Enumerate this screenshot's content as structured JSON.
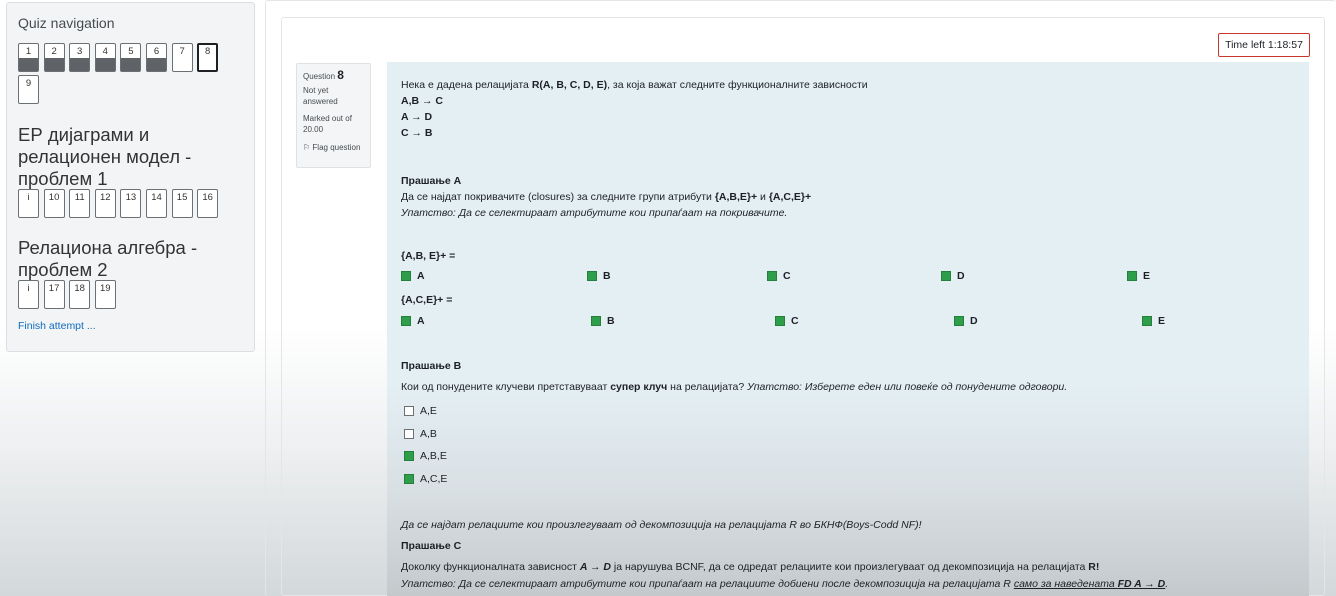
{
  "nav": {
    "title": "Quiz navigation",
    "row1": [
      "1",
      "2",
      "3",
      "4",
      "5",
      "6",
      "7",
      "8"
    ],
    "row2": [
      "9"
    ],
    "section1_title": "ЕР дијаграми и релационен модел - проблем 1",
    "section1": [
      "i",
      "10",
      "11",
      "12",
      "13",
      "14",
      "15",
      "16"
    ],
    "section2_title": "Релациона алгебра - проблем 2",
    "section2": [
      "i",
      "17",
      "18",
      "19"
    ],
    "finish": "Finish attempt ..."
  },
  "timer": {
    "label": "Time left",
    "value": "1:18:57"
  },
  "question": {
    "label": "Question",
    "number": "8",
    "state": "Not yet answered",
    "grade": "Marked out of 20.00",
    "flag": "Flag question"
  },
  "content": {
    "intro_pre": "Нека е дадена релацијата ",
    "intro_rel": "R(A, B, C, D, E)",
    "intro_post": ", за која важат следните функционалните зависности",
    "fd1": "A,B → C",
    "fd2": "A → D",
    "fd3": "C → B",
    "partA_title": "Прашање А",
    "partA_text_pre": "Да се најдат покривачите (closures) за следните групи атрибути ",
    "partA_set1": "{A,B,E}+",
    "partA_and": " и ",
    "partA_set2": "{A,C,E}+",
    "partA_hint": "Упатство: Да се селектираат атрибутите кои припаѓаат на покривачите.",
    "closure1_label": "{A,B, E}+ =",
    "closure2_label": "{A,C,E}+ =",
    "attrs": [
      "A",
      "B",
      "C",
      "D",
      "E"
    ],
    "partB_title": "Прашање B",
    "partB_text_pre": "Кои од понудените клучеви претставуваат ",
    "partB_bold": "супер клуч",
    "partB_text_post": " на релацијата? ",
    "partB_hint": "Упатство: Изберете еден или повеќе од понудените одговори.",
    "keys": [
      {
        "label": "A,E",
        "checked": false
      },
      {
        "label": "A,B",
        "checked": false
      },
      {
        "label": "A,B,E",
        "checked": true
      },
      {
        "label": "A,C,E",
        "checked": true
      }
    ],
    "decomp_note": "Да се најдат релациите кои произлегуваат од декомпозиција на релацијата R во БКНФ(Boys-Codd NF)!",
    "partC_title": "Прашање C",
    "partC_pre": "Доколку функционалната зависност ",
    "partC_fd": "A → D",
    "partC_mid": " ја нарушува BCNF, да се одредат релациите кои произлегуваат од декомпозиција на релацијата ",
    "partC_r": "R!",
    "partC_hint_pre": "Упатство: Да се селектираат атрибутите кои припаѓаат на релациите добиени после декомпозиција на релацијата R ",
    "partC_hint_u": "само за наведената ",
    "partC_hint_fd": "FD A → D",
    "partC_hint_end": "."
  }
}
